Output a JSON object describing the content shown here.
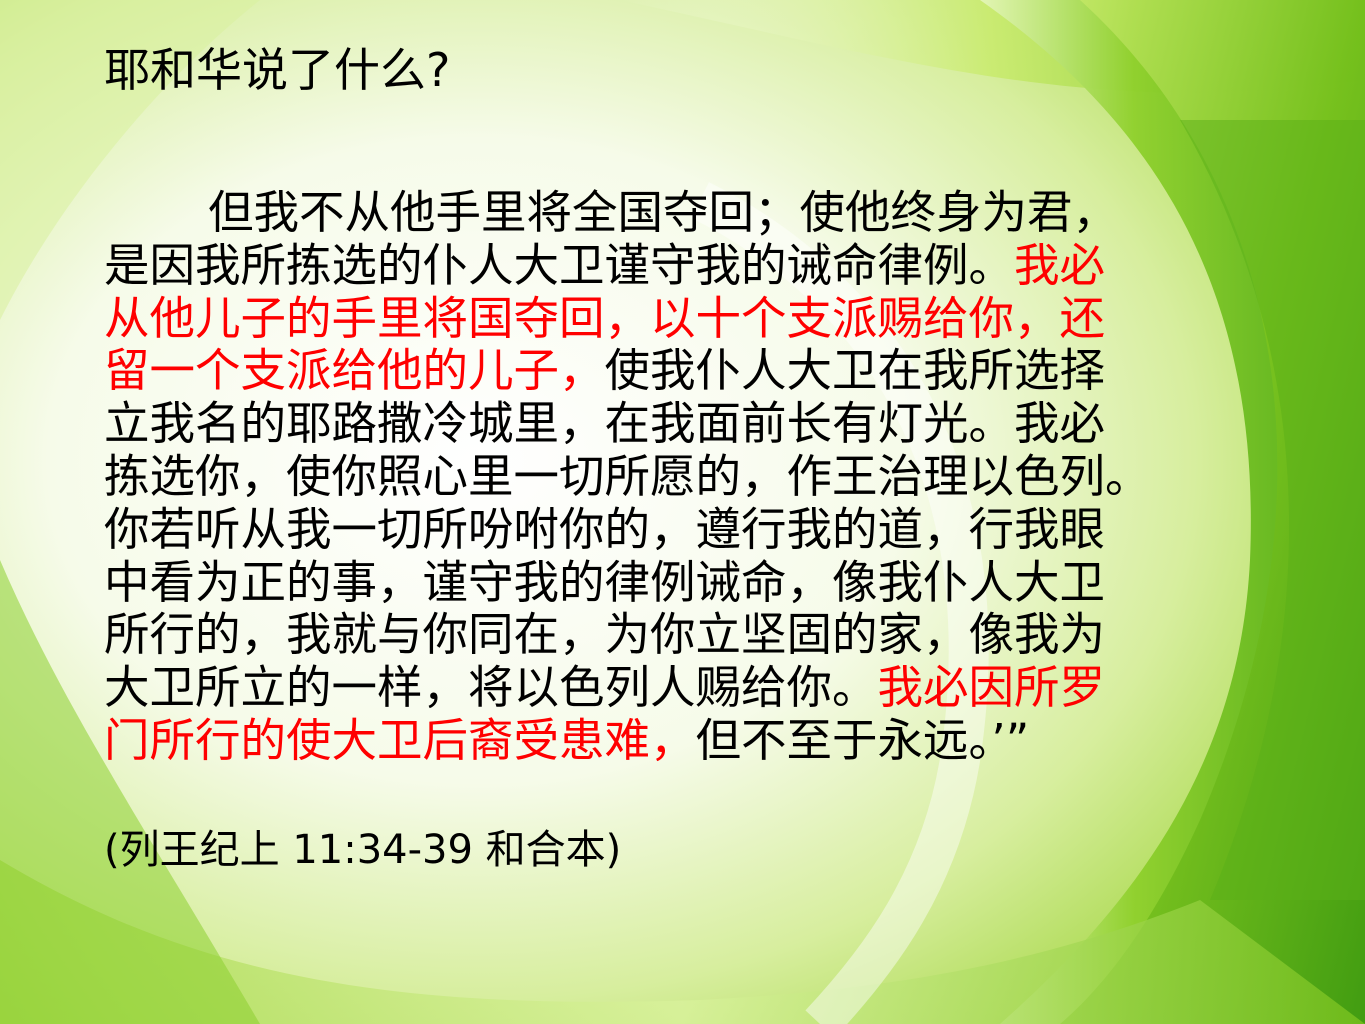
{
  "slide": {
    "title": "耶和华说了什么?",
    "lines": [
      {
        "segments": [
          {
            "text": "但我不从他手里将全国夺回；使他终身为君，",
            "color": "black"
          }
        ],
        "indent": true
      },
      {
        "segments": [
          {
            "text": "是因我所拣选的仆人大卫谨守我的诫命律例。",
            "color": "black"
          },
          {
            "text": "我必",
            "color": "red"
          }
        ]
      },
      {
        "segments": [
          {
            "text": "从他儿子的手里将国夺回，以十个支派赐给你，还",
            "color": "red"
          }
        ]
      },
      {
        "segments": [
          {
            "text": "留一个支派给他的儿子，",
            "color": "red"
          },
          {
            "text": "使我仆人大卫在我所选择",
            "color": "black"
          }
        ]
      },
      {
        "segments": [
          {
            "text": "立我名的耶路撒冷城里，在我面前长有灯光。我必",
            "color": "black"
          }
        ]
      },
      {
        "segments": [
          {
            "text": "拣选你，使你照心里一切所愿的，作王治理以色列。",
            "color": "black"
          }
        ]
      },
      {
        "segments": [
          {
            "text": "你若听从我一切所吩咐你的，遵行我的道，行我眼",
            "color": "black"
          }
        ]
      },
      {
        "segments": [
          {
            "text": "中看为正的事，谨守我的律例诫命，像我仆人大卫",
            "color": "black"
          }
        ]
      },
      {
        "segments": [
          {
            "text": "所行的，我就与你同在，为你立坚固的家，像我为",
            "color": "black"
          }
        ]
      },
      {
        "segments": [
          {
            "text": "大卫所立的一样，将以色列人赐给你。",
            "color": "black"
          },
          {
            "text": "我必因所罗",
            "color": "red"
          }
        ]
      },
      {
        "segments": [
          {
            "text": "门所行的使大卫后裔受患难，",
            "color": "red"
          },
          {
            "text": "但不至于永远。’”",
            "color": "black"
          }
        ]
      }
    ],
    "citation": "(列王纪上 11:34-39 和合本)"
  },
  "colors": {
    "text": "#000000",
    "highlight": "#ff0000",
    "background_light": "#ffffff",
    "background_green": "#7cc41e"
  }
}
